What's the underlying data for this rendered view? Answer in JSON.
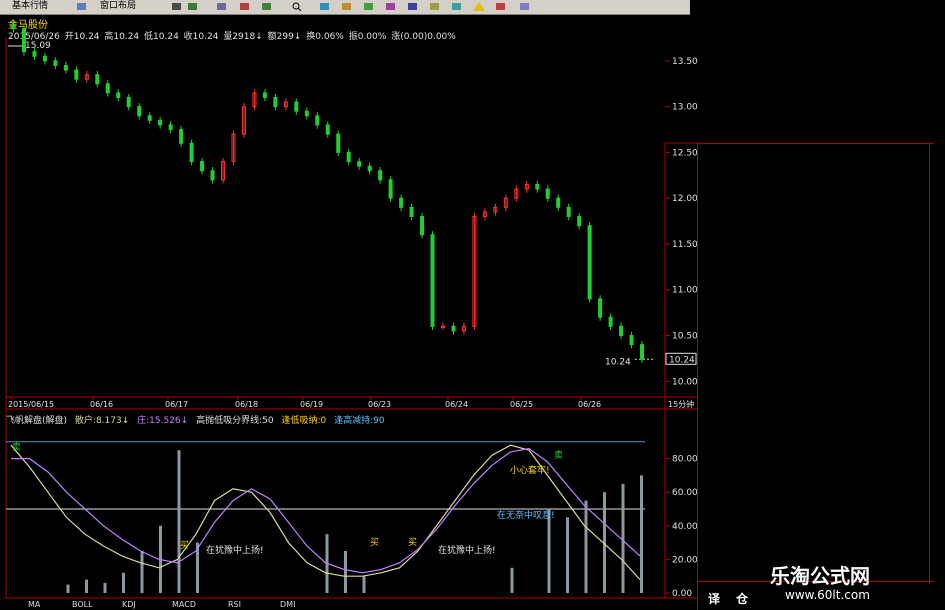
{
  "toolbar": {
    "items": [
      "基本行情",
      "窗口布局"
    ]
  },
  "header": {
    "stock_name": "金马股份",
    "quote": {
      "date": "2015/06/26",
      "open": "开10.24",
      "high": "高10.24",
      "low": "低10.24",
      "close": "收10.24",
      "volume": "量2918↓",
      "amount": "额299↓",
      "turnover": "换0.06%",
      "amplitude": "振0.00%",
      "change": "涨(0.00)0.00%"
    }
  },
  "indicator": {
    "name": "飞帆解盘(解盘)",
    "retail": "散户:8.173↓",
    "dealer": "庄:15.526↓",
    "boundary": "高抛低吸分界线:50",
    "absorb": "逢低吸纳:0",
    "reduce": "逢高减持:90"
  },
  "right_panel": {
    "tabs": [
      "译",
      "仓"
    ]
  },
  "bottom_tabs": [
    "MA",
    "BOLL",
    "KDJ",
    "MACD",
    "RSI",
    "DMI"
  ],
  "watermark": {
    "title": "乐淘公式网",
    "url": "www.60lt.com"
  },
  "colors": {
    "up": "#ff3030",
    "down": "#20d030",
    "axis": "#b00000",
    "retail_line": "#d9d9a0",
    "dealer_line": "#c080ff"
  },
  "chart_data": [
    {
      "type": "candlestick",
      "title": "金马股份",
      "y_ticks": [
        "13.50",
        "13.00",
        "12.50",
        "12.00",
        "11.50",
        "11.00",
        "10.50",
        "10.00"
      ],
      "ylim": [
        9.85,
        13.75
      ],
      "x_ticks": [
        "2015/06/15",
        "06/16",
        "06/17",
        "06/18",
        "06/19",
        "06/23",
        "06/24",
        "06/25",
        "06/26"
      ],
      "timeframe": "15分钟",
      "max_label": "15.09",
      "last_price": "10.24",
      "closes": [
        13.85,
        13.6,
        13.55,
        13.5,
        13.45,
        13.4,
        13.3,
        13.35,
        13.25,
        13.15,
        13.1,
        13.0,
        12.9,
        12.85,
        12.8,
        12.75,
        12.6,
        12.4,
        12.3,
        12.2,
        12.4,
        12.7,
        13.0,
        13.15,
        13.1,
        13.0,
        13.05,
        12.95,
        12.9,
        12.8,
        12.7,
        12.5,
        12.4,
        12.35,
        12.3,
        12.2,
        12.0,
        11.9,
        11.8,
        11.6,
        10.6,
        10.6,
        10.55,
        10.6,
        11.8,
        11.85,
        11.9,
        12.0,
        12.1,
        12.15,
        12.1,
        12.0,
        11.9,
        11.8,
        11.7,
        10.9,
        10.7,
        10.6,
        10.5,
        10.4,
        10.24
      ]
    },
    {
      "type": "line",
      "title": "飞帆解盘(解盘)",
      "y_ticks": [
        "80.00",
        "60.00",
        "40.00",
        "20.00",
        "0.00"
      ],
      "ylim": [
        0,
        100
      ],
      "reference_lines": [
        50,
        90
      ],
      "series": [
        {
          "name": "散户",
          "values": [
            88,
            75,
            60,
            45,
            35,
            28,
            22,
            18,
            15,
            20,
            35,
            55,
            62,
            60,
            48,
            30,
            18,
            12,
            10,
            10,
            12,
            15,
            25,
            40,
            55,
            70,
            82,
            88,
            85,
            70,
            55,
            40,
            30,
            20,
            8
          ]
        },
        {
          "name": "庄",
          "values": [
            80,
            80,
            72,
            60,
            50,
            40,
            32,
            25,
            20,
            18,
            25,
            42,
            55,
            62,
            56,
            42,
            28,
            18,
            14,
            12,
            14,
            18,
            26,
            38,
            52,
            65,
            76,
            84,
            86,
            78,
            65,
            52,
            42,
            32,
            22
          ]
        }
      ],
      "bars": [
        0,
        0,
        0,
        5,
        8,
        6,
        12,
        25,
        40,
        85,
        30,
        0,
        0,
        0,
        0,
        0,
        0,
        35,
        25,
        10,
        0,
        0,
        0,
        0,
        0,
        0,
        0,
        15,
        0,
        50,
        45,
        55,
        60,
        65,
        70
      ],
      "annotations": [
        "买",
        "在犹豫中上扬!",
        "买",
        "买",
        "在犹豫中上扬!",
        "小心套牢!",
        "在无奈中叹息!",
        "卖",
        "卖"
      ]
    }
  ]
}
